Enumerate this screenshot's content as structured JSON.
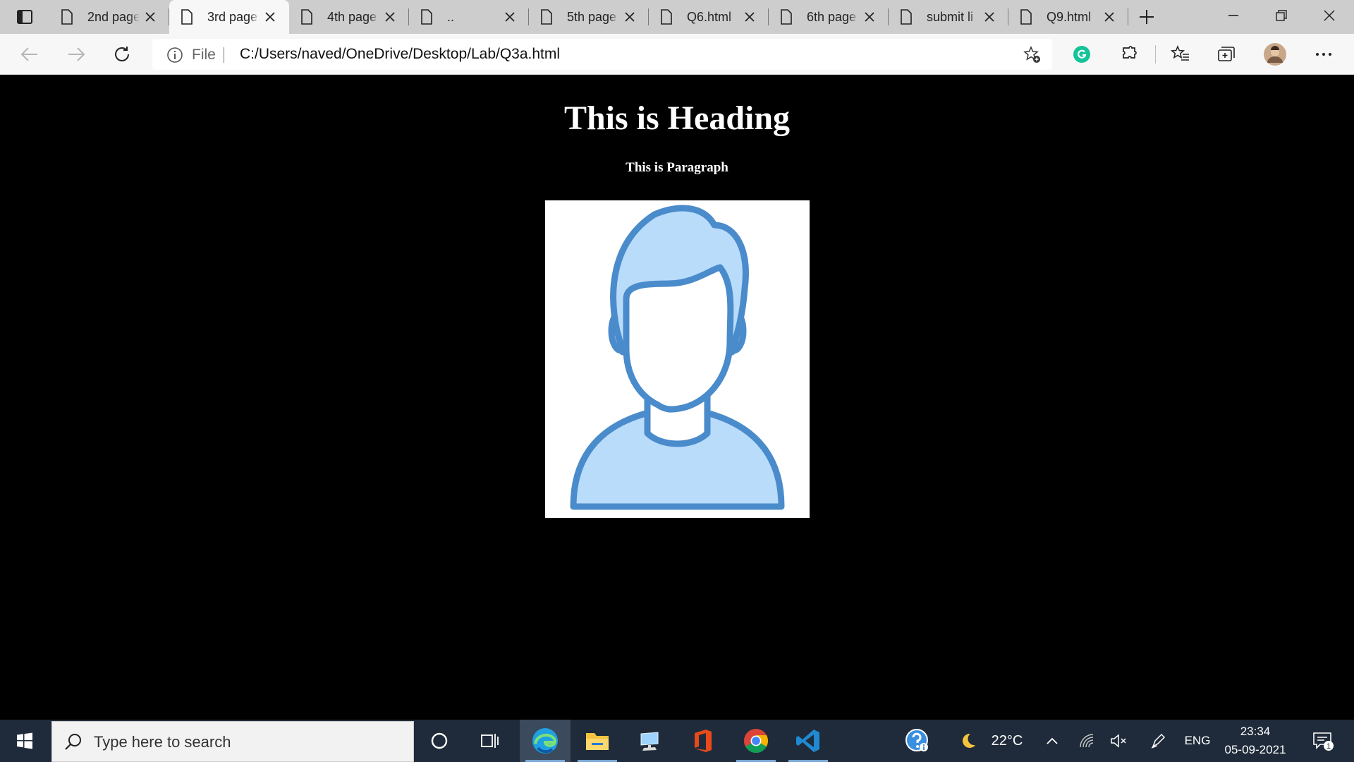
{
  "browser": {
    "tabs": [
      {
        "label": "2nd page",
        "active": false
      },
      {
        "label": "3rd page",
        "active": true
      },
      {
        "label": "4th page",
        "active": false
      },
      {
        "label": "..",
        "active": false
      },
      {
        "label": "5th page",
        "active": false
      },
      {
        "label": "Q6.html",
        "active": false
      },
      {
        "label": "6th page",
        "active": false
      },
      {
        "label": "submit li",
        "active": false
      },
      {
        "label": "Q9.html",
        "active": false
      }
    ],
    "address": {
      "scheme_label": "File",
      "url": "C:/Users/naved/OneDrive/Desktop/Lab/Q3a.html"
    },
    "toolbar_icons": [
      "add-favorite-icon",
      "grammarly-icon",
      "extensions-icon",
      "favorites-icon",
      "collections-icon",
      "profile-avatar",
      "more-options-icon"
    ]
  },
  "page": {
    "heading": "This is Heading",
    "paragraph": "This is Paragraph",
    "image": {
      "icon": "user-avatar-icon",
      "fill": "#b9dcfb",
      "stroke": "#4a8bcb"
    }
  },
  "taskbar": {
    "search_placeholder": "Type here to search",
    "apps": [
      "cortana-icon",
      "task-view-icon",
      "edge-icon",
      "file-explorer-icon",
      "remote-desktop-icon",
      "office-icon",
      "chrome-icon",
      "vscode-icon"
    ],
    "weather": {
      "temperature": "22°C",
      "icon": "moon-icon"
    },
    "language": "ENG",
    "time": "23:34",
    "date": "05-09-2021",
    "notification_count": "1"
  },
  "colors": {
    "tabstrip_bg": "#cdcdcd",
    "toolbar_bg": "#f7f7f7",
    "page_bg": "#000000",
    "taskbar_bg": "#1f2b3a",
    "grammarly_green": "#15c39a"
  }
}
